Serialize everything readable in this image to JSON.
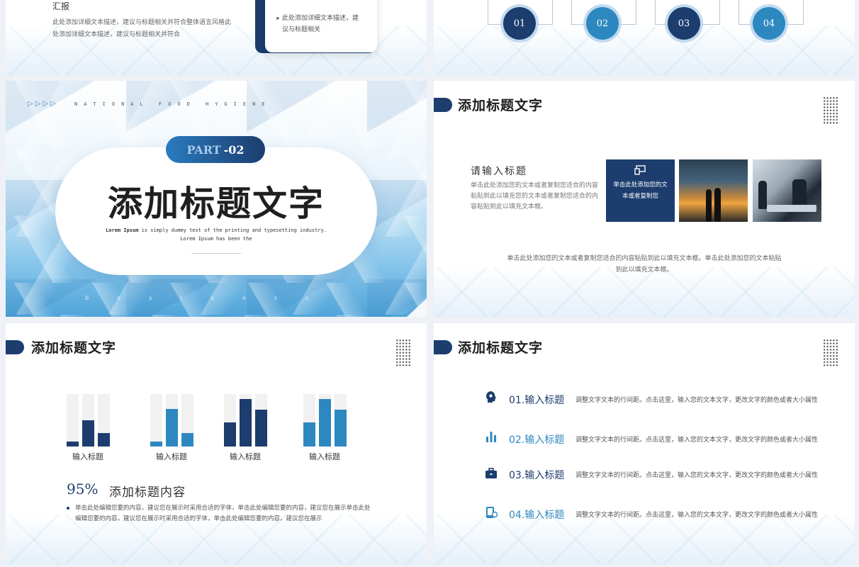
{
  "slide1": {
    "title": "汇报",
    "desc": "此处添加详细文本描述，建议与标题相关并符合整体语言风格此处添加详细文本描述，建议与标题相关并符合",
    "card_bullet": "此处添加详细文本描述，建议与标题相关"
  },
  "slide2": {
    "steps": [
      "01",
      "02",
      "03",
      "04"
    ],
    "step_colors": [
      "#1c3d6e",
      "#2e88c0",
      "#1c3d6e",
      "#2e88c0"
    ]
  },
  "slide3": {
    "arrows": "▷▷▷▷",
    "national": "NATIONAL FOOD HYGIENE",
    "part_a": "PART",
    "part_b": "-02",
    "title": "添加标题文字",
    "lorem_bold": "Lorem Ipsum",
    "lorem_rest": " is simply dummy text of the printing and typesetting industry.",
    "lorem_line2": "Lorem Ipsum has been the",
    "business": "business"
  },
  "slide4": {
    "heading": "添加标题文字",
    "input_title": "请输入标题",
    "input_desc": "单击此处添加您的文本或者复制您适合的内容粘贴到此以填充您的文本或者复制您适合的内容粘贴到此以填充文本框。",
    "navy_text": "单击此处添加您的文本或者复制您",
    "footer": "单击此处添加您的文本或者复制您适合的内容粘贴到此以填充文本框。单击此处添加您的文本粘贴到此以填充文本框。"
  },
  "slide5": {
    "heading": "添加标题文字",
    "groups": [
      {
        "label": "输入标题",
        "levels": [
          0.1,
          0.5,
          0.26
        ],
        "colors": [
          "#1c3d6e",
          "#1c3d6e",
          "#1c3d6e"
        ]
      },
      {
        "label": "输入标题",
        "levels": [
          0.1,
          0.72,
          0.26
        ],
        "colors": [
          "#2e88c0",
          "#2e88c0",
          "#2e88c0"
        ]
      },
      {
        "label": "输入标题",
        "levels": [
          0.46,
          0.9,
          0.7
        ],
        "colors": [
          "#1c3d6e",
          "#1c3d6e",
          "#1c3d6e"
        ]
      },
      {
        "label": "输入标题",
        "levels": [
          0.46,
          0.9,
          0.7
        ],
        "colors": [
          "#2e88c0",
          "#2e88c0",
          "#2e88c0"
        ]
      }
    ],
    "percent": "95%",
    "content_title": "添加标题内容",
    "body": "单击此处编辑您要的内容，建议您在展示时采用合适的字体，单击此处编辑您要的内容，建议您在展示单击此处编辑您要的内容，建议您在展示时采用合适的字体，单击此处编辑您要的内容，建议您在展示"
  },
  "slide6": {
    "heading": "添加标题文字",
    "rows": [
      {
        "icon": "head-gear-icon",
        "title": "01.输入标题",
        "color": "#1c3d6e",
        "desc": "调整文字文本的行间距。点击这里，输入您的文本文字，更改文字的颜色或者大小属性"
      },
      {
        "icon": "bar-chart-icon",
        "title": "02.输入标题",
        "color": "#2e88c0",
        "desc": "调整文字文本的行间距。点击这里，输入您的文本文字，更改文字的颜色或者大小属性"
      },
      {
        "icon": "briefcase-icon",
        "title": "03.输入标题",
        "color": "#1c3d6e",
        "desc": "调整文字文本的行间距。点击这里，输入您的文本文字，更改文字的颜色或者大小属性"
      },
      {
        "icon": "phone-icon",
        "title": "04.输入标题",
        "color": "#2e88c0",
        "desc": "调整文字文本的行间距。点击这里，输入您的文本文字，更改文字的颜色或者大小属性"
      }
    ]
  }
}
